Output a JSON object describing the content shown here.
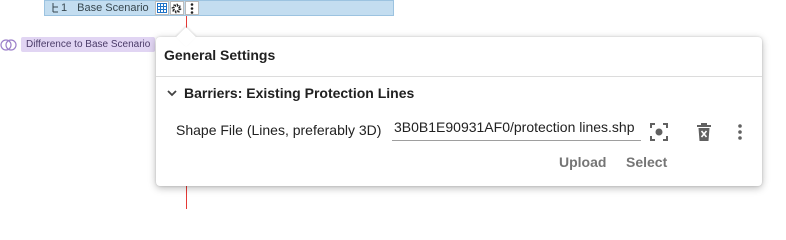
{
  "scenario_bar": {
    "index": "1",
    "name": "Base Scenario"
  },
  "difference_label": "Difference to Base Scenario",
  "popover": {
    "title": "General Settings",
    "section_title": "Barriers: Existing Protection Lines",
    "field_label": "Shape File (Lines, preferably 3D)",
    "field_value": "3B0B1E90931AF0/protection lines.shp",
    "upload_label": "Upload",
    "select_label": "Select"
  },
  "colors": {
    "scenario_bar": "#c3ddf0",
    "difference_chip": "#e1d5f3",
    "marker_line": "#e53935"
  }
}
